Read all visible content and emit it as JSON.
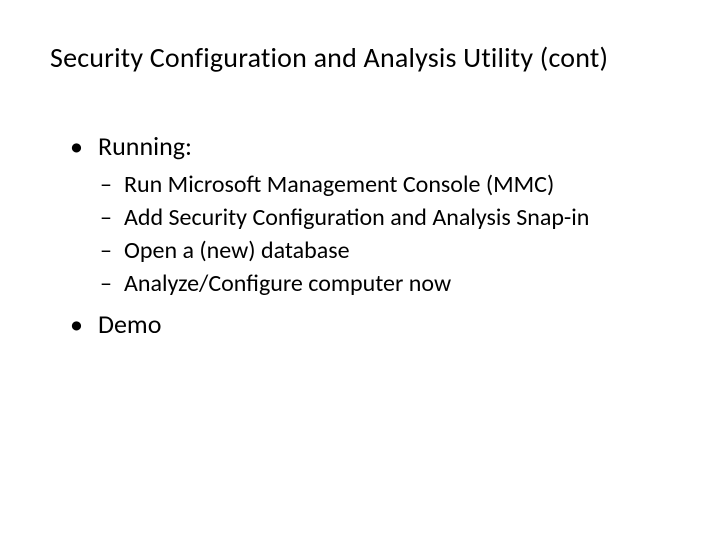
{
  "title": "Security Configuration and Analysis Utility (cont)",
  "bullets": {
    "running": {
      "label": "Running:",
      "subs": {
        "s0": "Run Microsoft Management Console (MMC)",
        "s1": "Add Security Configuration and Analysis Snap-in",
        "s2": "Open a (new) database",
        "s3": "Analyze/Configure computer now"
      }
    },
    "demo": {
      "label": "Demo"
    }
  }
}
